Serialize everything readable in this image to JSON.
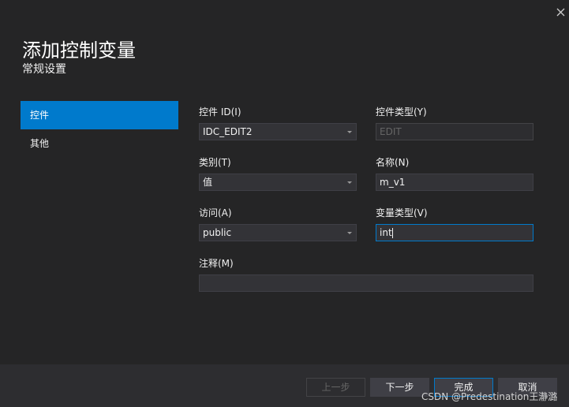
{
  "dialog": {
    "title": "添加控制变量",
    "subtitle": "常规设置"
  },
  "sidebar": {
    "items": [
      {
        "label": "控件",
        "active": true
      },
      {
        "label": "其他",
        "active": false
      }
    ]
  },
  "form": {
    "control_id": {
      "label": "控件 ID(I)",
      "value": "IDC_EDIT2"
    },
    "control_type": {
      "label": "控件类型(Y)",
      "value": "EDIT"
    },
    "category": {
      "label": "类别(T)",
      "value": "值"
    },
    "name": {
      "label": "名称(N)",
      "value": "m_v1"
    },
    "access": {
      "label": "访问(A)",
      "value": "public"
    },
    "variable_type": {
      "label": "变量类型(V)",
      "value": "int"
    },
    "comment": {
      "label": "注释(M)",
      "value": ""
    }
  },
  "buttons": {
    "prev": "上一步",
    "next": "下一步",
    "finish": "完成",
    "cancel": "取消"
  },
  "watermark": "CSDN @Predestination王瀞潞",
  "colors": {
    "background": "#252526",
    "accent": "#007acc",
    "field_bg": "#333337"
  }
}
